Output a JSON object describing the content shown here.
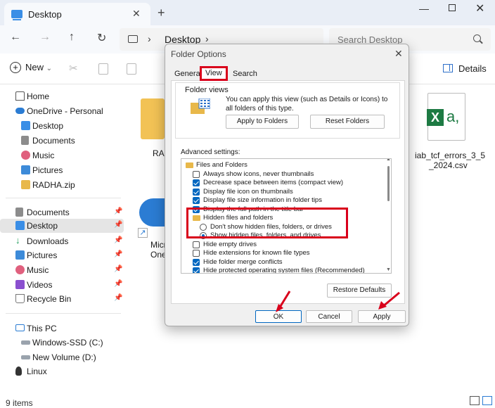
{
  "explorer": {
    "tab_title": "Desktop",
    "tab_close": "✕",
    "new_tab": "+",
    "window_min": "—",
    "window_close": "✕",
    "nav": {
      "back": "←",
      "forward": "→",
      "up": "↑",
      "refresh": "↻"
    },
    "address": {
      "separator": "›",
      "location": "Desktop"
    },
    "search_placeholder": "Search Desktop",
    "toolbar": {
      "new_label": "New",
      "new_chevron": "⌄",
      "details_label": "Details"
    },
    "sidebar": {
      "items": [
        {
          "label": "Home",
          "icon": "home-icon"
        },
        {
          "label": "OneDrive - Personal",
          "icon": "cloud-icon"
        },
        {
          "label": "Desktop",
          "icon": "desktop-folder-icon"
        },
        {
          "label": "Documents",
          "icon": "documents-icon"
        },
        {
          "label": "Music",
          "icon": "music-icon"
        },
        {
          "label": "Pictures",
          "icon": "pictures-icon"
        },
        {
          "label": "RADHA.zip",
          "icon": "zip-icon"
        }
      ],
      "quick_access": [
        {
          "label": "Documents",
          "icon": "documents-icon"
        },
        {
          "label": "Desktop",
          "icon": "desktop-folder-icon"
        },
        {
          "label": "Downloads",
          "icon": "downloads-icon"
        },
        {
          "label": "Pictures",
          "icon": "pictures-icon"
        },
        {
          "label": "Music",
          "icon": "music-icon"
        },
        {
          "label": "Videos",
          "icon": "videos-icon"
        },
        {
          "label": "Recycle Bin",
          "icon": "recycle-bin-icon"
        }
      ],
      "pin_glyph": "📌",
      "devices": [
        {
          "label": "This PC",
          "icon": "this-pc-icon"
        },
        {
          "label": "Windows-SSD (C:)",
          "icon": "drive-icon"
        },
        {
          "label": "New Volume (D:)",
          "icon": "drive-icon"
        },
        {
          "label": "Linux",
          "icon": "linux-icon"
        }
      ]
    },
    "files": [
      {
        "label": "RAD",
        "icon": "folder-icon"
      },
      {
        "label": "Micr",
        "label2": "One",
        "icon": "onedrive-shortcut-icon"
      },
      {
        "label": "iab_tcf_errors_3_5",
        "label2": "_2024.csv",
        "icon": "excel-csv-icon",
        "badge_letter": "X",
        "badge_suffix": "a,"
      }
    ],
    "status": "9 items"
  },
  "dialog": {
    "title": "Folder Options",
    "close": "✕",
    "tabs": [
      "General",
      "View",
      "Search"
    ],
    "active_tab": "View",
    "folder_views": {
      "title": "Folder views",
      "description": "You can apply this view (such as Details or Icons) to all folders of this type.",
      "apply_button": "Apply to Folders",
      "reset_button": "Reset Folders"
    },
    "advanced_label": "Advanced settings:",
    "settings": [
      {
        "type": "folder",
        "label": "Files and Folders",
        "indent": 0
      },
      {
        "type": "unchecked",
        "label": "Always show icons, never thumbnails",
        "indent": 1
      },
      {
        "type": "checked",
        "label": "Decrease space between items (compact view)",
        "indent": 1
      },
      {
        "type": "checked",
        "label": "Display file icon on thumbnails",
        "indent": 1
      },
      {
        "type": "checked",
        "label": "Display file size information in folder tips",
        "indent": 1
      },
      {
        "type": "checked",
        "label": "Display the full path in the title bar",
        "indent": 1
      },
      {
        "type": "folder",
        "label": "Hidden files and folders",
        "indent": 1
      },
      {
        "type": "radio",
        "label": "Don't show hidden files, folders, or drives",
        "indent": 2,
        "selected": false
      },
      {
        "type": "radio",
        "label": "Show hidden files, folders, and drives",
        "indent": 2,
        "selected": true
      },
      {
        "type": "unchecked",
        "label": "Hide empty drives",
        "indent": 1
      },
      {
        "type": "unchecked",
        "label": "Hide extensions for known file types",
        "indent": 1
      },
      {
        "type": "checked",
        "label": "Hide folder merge conflicts",
        "indent": 1
      },
      {
        "type": "checked",
        "label": "Hide protected operating system files (Recommended)",
        "indent": 1
      }
    ],
    "restore_button": "Restore Defaults",
    "ok_button": "OK",
    "cancel_button": "Cancel",
    "apply_button": "Apply",
    "accent_color": "#0067c0",
    "highlight_color": "#d9001b"
  }
}
